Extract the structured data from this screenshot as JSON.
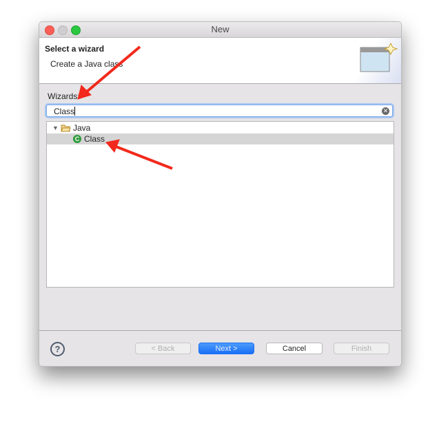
{
  "window": {
    "title": "New"
  },
  "header": {
    "title": "Select a wizard",
    "subtitle": "Create a Java class"
  },
  "wizards_label": "Wizards:",
  "search": {
    "value": "Class"
  },
  "tree": {
    "items": [
      {
        "label": "Java",
        "icon": "folder-open-icon",
        "expanded": true
      },
      {
        "label": "Class",
        "icon": "java-class-icon",
        "selected": true
      }
    ]
  },
  "buttons": {
    "back": "< Back",
    "next": "Next >",
    "cancel": "Cancel",
    "finish": "Finish"
  },
  "colors": {
    "accent": "#1a73f5",
    "annotation": "#f2291c"
  }
}
